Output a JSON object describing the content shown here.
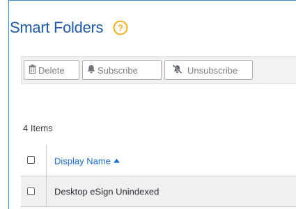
{
  "page": {
    "title": "Smart Folders",
    "help_symbol": "?"
  },
  "toolbar": {
    "delete_label": "Delete",
    "subscribe_label": "Subscribe",
    "unsubscribe_label": "Unsubscribe"
  },
  "grid": {
    "items_count": "4 Items",
    "columns": [
      {
        "label": "Display Name",
        "sort": "ascending"
      }
    ],
    "rows": [
      {
        "display_name": "Desktop eSign Unindexed"
      }
    ]
  },
  "colors": {
    "accent": "#1f5aa3",
    "link": "#1e6fc6",
    "help": "#f2b01e"
  }
}
